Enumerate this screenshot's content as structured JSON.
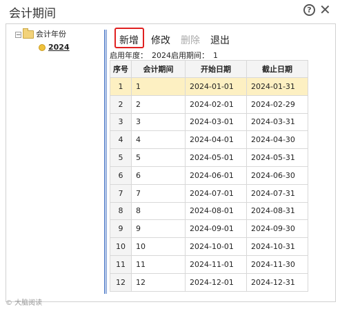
{
  "window": {
    "title": "会计期间"
  },
  "tree": {
    "root_toggle": "−",
    "root_label": "会计年份",
    "child_label": "2024"
  },
  "toolbar": {
    "add_label": "新增",
    "edit_label": "修改",
    "delete_label": "删除",
    "exit_label": "退出"
  },
  "info": {
    "start_year_label": "启用年度：",
    "start_year_value": "2024",
    "start_period_label": "启用期间：",
    "start_period_value": "1"
  },
  "table": {
    "headers": [
      "序号",
      "会计期间",
      "开始日期",
      "截止日期"
    ],
    "selected_row": 0,
    "rows": [
      [
        "1",
        "1",
        "2024-01-01",
        "2024-01-31"
      ],
      [
        "2",
        "2",
        "2024-02-01",
        "2024-02-29"
      ],
      [
        "3",
        "3",
        "2024-03-01",
        "2024-03-31"
      ],
      [
        "4",
        "4",
        "2024-04-01",
        "2024-04-30"
      ],
      [
        "5",
        "5",
        "2024-05-01",
        "2024-05-31"
      ],
      [
        "6",
        "6",
        "2024-06-01",
        "2024-06-30"
      ],
      [
        "7",
        "7",
        "2024-07-01",
        "2024-07-31"
      ],
      [
        "8",
        "8",
        "2024-08-01",
        "2024-08-31"
      ],
      [
        "9",
        "9",
        "2024-09-01",
        "2024-09-30"
      ],
      [
        "10",
        "10",
        "2024-10-01",
        "2024-10-31"
      ],
      [
        "11",
        "11",
        "2024-11-01",
        "2024-11-30"
      ],
      [
        "12",
        "12",
        "2024-12-01",
        "2024-12-31"
      ]
    ]
  },
  "watermark": "© 大脑阅读",
  "colors": {
    "highlight": "#e02020",
    "selected_row": "#fdf0c2",
    "splitter": "#6a8fd0"
  }
}
